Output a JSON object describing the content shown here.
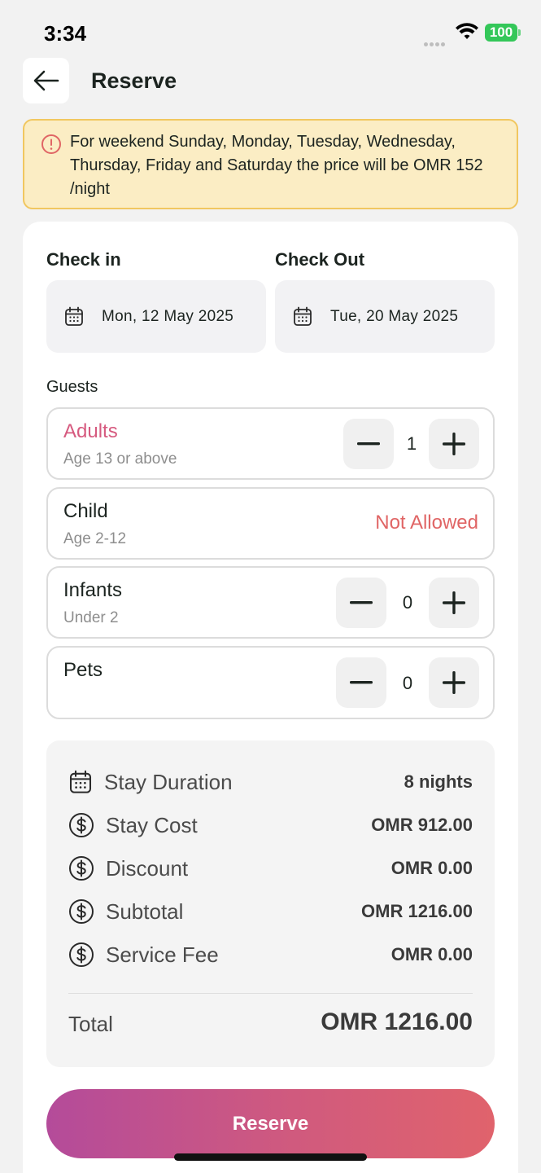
{
  "status_bar": {
    "time": "3:34",
    "battery": "100"
  },
  "header": {
    "title": "Reserve"
  },
  "notice": {
    "text": "For weekend Sunday, Monday, Tuesday, Wednesday, Thursday, Friday and Saturday the price will be OMR 152 /night"
  },
  "dates": {
    "check_in_label": "Check in",
    "check_in_value": "Mon, 12 May 2025",
    "check_out_label": "Check Out",
    "check_out_value": "Tue, 20 May 2025"
  },
  "guests": {
    "label": "Guests",
    "adults": {
      "title": "Adults",
      "subtitle": "Age 13 or above",
      "count": "1"
    },
    "child": {
      "title": "Child",
      "subtitle": "Age 2-12",
      "status": "Not Allowed"
    },
    "infants": {
      "title": "Infants",
      "subtitle": "Under 2",
      "count": "0"
    },
    "pets": {
      "title": "Pets",
      "count": "0"
    }
  },
  "summary": {
    "stay_duration_label": "Stay Duration",
    "stay_duration_value": "8 nights",
    "stay_cost_label": "Stay Cost",
    "stay_cost_value": "OMR 912.00",
    "discount_label": "Discount",
    "discount_value": "OMR 0.00",
    "subtotal_label": "Subtotal",
    "subtotal_value": "OMR 1216.00",
    "service_fee_label": "Service Fee",
    "service_fee_value": "OMR 0.00",
    "total_label": "Total",
    "total_value": "OMR 1216.00"
  },
  "reserve_button": {
    "label": "Reserve"
  },
  "colors": {
    "accent_pink": "#d65a7f",
    "not_allowed": "#e06565",
    "notice_bg": "#fbedc4",
    "notice_border": "#f1c760",
    "gradient_start": "#b44b9a",
    "gradient_end": "#e0636c"
  }
}
